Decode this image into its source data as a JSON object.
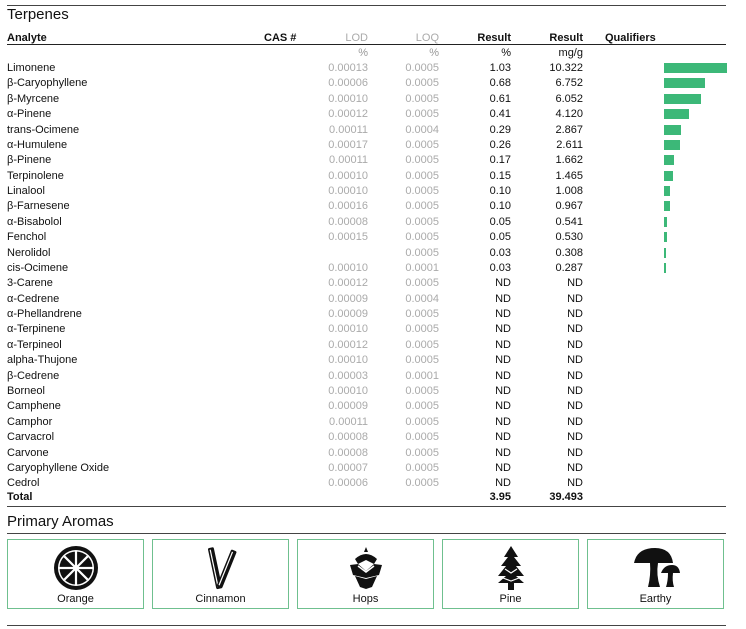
{
  "terpenes": {
    "title": "Terpenes",
    "headers": {
      "analyte": "Analyte",
      "cas": "CAS #",
      "lod": "LOD",
      "loq": "LOQ",
      "result_pct": "Result",
      "result_mg": "Result",
      "qualifiers": "Qualifiers"
    },
    "units": {
      "lod": "%",
      "loq": "%",
      "result_pct": "%",
      "result_mg": "mg/g"
    },
    "rows": [
      {
        "analyte": "Limonene",
        "lod": "0.00013",
        "loq": "0.0005",
        "pct": "1.03",
        "mg": "10.322"
      },
      {
        "analyte": "β-Caryophyllene",
        "lod": "0.00006",
        "loq": "0.0005",
        "pct": "0.68",
        "mg": "6.752"
      },
      {
        "analyte": "β-Myrcene",
        "lod": "0.00010",
        "loq": "0.0005",
        "pct": "0.61",
        "mg": "6.052"
      },
      {
        "analyte": "α-Pinene",
        "lod": "0.00012",
        "loq": "0.0005",
        "pct": "0.41",
        "mg": "4.120"
      },
      {
        "analyte": "trans-Ocimene",
        "lod": "0.00011",
        "loq": "0.0004",
        "pct": "0.29",
        "mg": "2.867"
      },
      {
        "analyte": "α-Humulene",
        "lod": "0.00017",
        "loq": "0.0005",
        "pct": "0.26",
        "mg": "2.611"
      },
      {
        "analyte": "β-Pinene",
        "lod": "0.00011",
        "loq": "0.0005",
        "pct": "0.17",
        "mg": "1.662"
      },
      {
        "analyte": "Terpinolene",
        "lod": "0.00010",
        "loq": "0.0005",
        "pct": "0.15",
        "mg": "1.465"
      },
      {
        "analyte": "Linalool",
        "lod": "0.00010",
        "loq": "0.0005",
        "pct": "0.10",
        "mg": "1.008"
      },
      {
        "analyte": "β-Farnesene",
        "lod": "0.00016",
        "loq": "0.0005",
        "pct": "0.10",
        "mg": "0.967"
      },
      {
        "analyte": "α-Bisabolol",
        "lod": "0.00008",
        "loq": "0.0005",
        "pct": "0.05",
        "mg": "0.541"
      },
      {
        "analyte": "Fenchol",
        "lod": "0.00015",
        "loq": "0.0005",
        "pct": "0.05",
        "mg": "0.530"
      },
      {
        "analyte": "Nerolidol",
        "lod": "",
        "loq": "0.0005",
        "pct": "0.03",
        "mg": "0.308"
      },
      {
        "analyte": "cis-Ocimene",
        "lod": "0.00010",
        "loq": "0.0001",
        "pct": "0.03",
        "mg": "0.287"
      },
      {
        "analyte": "3-Carene",
        "lod": "0.00012",
        "loq": "0.0005",
        "pct": "ND",
        "mg": "ND"
      },
      {
        "analyte": "α-Cedrene",
        "lod": "0.00009",
        "loq": "0.0004",
        "pct": "ND",
        "mg": "ND"
      },
      {
        "analyte": "α-Phellandrene",
        "lod": "0.00009",
        "loq": "0.0005",
        "pct": "ND",
        "mg": "ND"
      },
      {
        "analyte": "α-Terpinene",
        "lod": "0.00010",
        "loq": "0.0005",
        "pct": "ND",
        "mg": "ND"
      },
      {
        "analyte": "α-Terpineol",
        "lod": "0.00012",
        "loq": "0.0005",
        "pct": "ND",
        "mg": "ND"
      },
      {
        "analyte": "alpha-Thujone",
        "lod": "0.00010",
        "loq": "0.0005",
        "pct": "ND",
        "mg": "ND"
      },
      {
        "analyte": "β-Cedrene",
        "lod": "0.00003",
        "loq": "0.0001",
        "pct": "ND",
        "mg": "ND"
      },
      {
        "analyte": "Borneol",
        "lod": "0.00010",
        "loq": "0.0005",
        "pct": "ND",
        "mg": "ND"
      },
      {
        "analyte": "Camphene",
        "lod": "0.00009",
        "loq": "0.0005",
        "pct": "ND",
        "mg": "ND"
      },
      {
        "analyte": "Camphor",
        "lod": "0.00011",
        "loq": "0.0005",
        "pct": "ND",
        "mg": "ND"
      },
      {
        "analyte": "Carvacrol",
        "lod": "0.00008",
        "loq": "0.0005",
        "pct": "ND",
        "mg": "ND"
      },
      {
        "analyte": "Carvone",
        "lod": "0.00008",
        "loq": "0.0005",
        "pct": "ND",
        "mg": "ND"
      },
      {
        "analyte": "Caryophyllene Oxide",
        "lod": "0.00007",
        "loq": "0.0005",
        "pct": "ND",
        "mg": "ND"
      },
      {
        "analyte": "Cedrol",
        "lod": "0.00006",
        "loq": "0.0005",
        "pct": "ND",
        "mg": "ND"
      }
    ],
    "total": {
      "label": "Total",
      "pct": "3.95",
      "mg": "39.493"
    },
    "bar_color": "#3cb878"
  },
  "aromas": {
    "title": "Primary Aromas",
    "border_color": "#6fc08f",
    "items": [
      {
        "label": "Orange",
        "icon": "orange-slice-icon"
      },
      {
        "label": "Cinnamon",
        "icon": "cinnamon-sticks-icon"
      },
      {
        "label": "Hops",
        "icon": "hops-icon"
      },
      {
        "label": "Pine",
        "icon": "pine-tree-icon"
      },
      {
        "label": "Earthy",
        "icon": "mushroom-icon"
      }
    ]
  }
}
